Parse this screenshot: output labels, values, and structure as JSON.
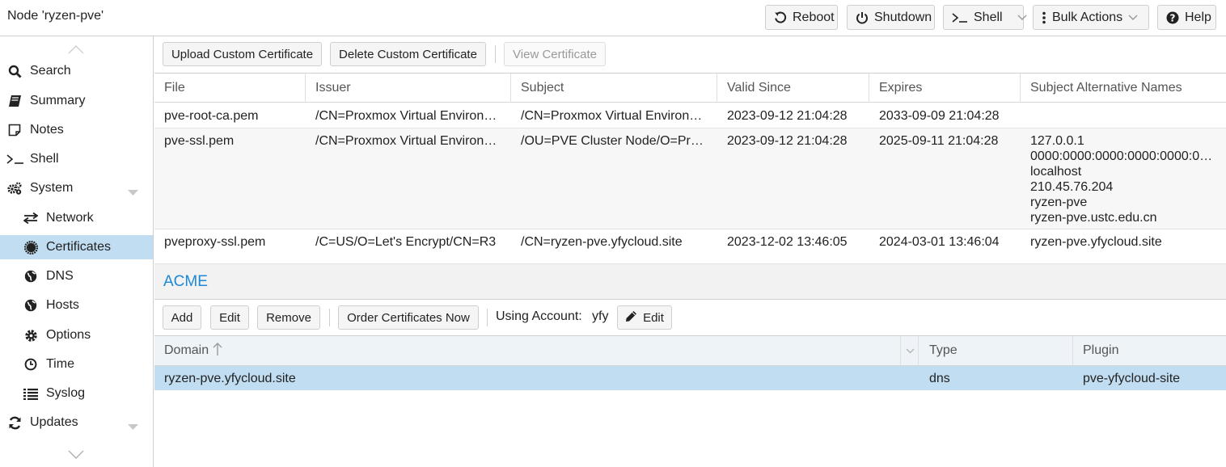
{
  "header": {
    "title": "Node 'ryzen-pve'",
    "reboot": "Reboot",
    "shutdown": "Shutdown",
    "shell": "Shell",
    "bulk_actions": "Bulk Actions",
    "help": "Help"
  },
  "sidebar": {
    "items": [
      {
        "label": "Search",
        "icon": "search-icon"
      },
      {
        "label": "Summary",
        "icon": "book-icon"
      },
      {
        "label": "Notes",
        "icon": "note-icon"
      },
      {
        "label": "Shell",
        "icon": "terminal-icon"
      },
      {
        "label": "System",
        "icon": "gears-icon"
      },
      {
        "label": "Network",
        "icon": "exchange-icon"
      },
      {
        "label": "Certificates",
        "icon": "certificate-icon"
      },
      {
        "label": "DNS",
        "icon": "globe-icon"
      },
      {
        "label": "Hosts",
        "icon": "globe-icon"
      },
      {
        "label": "Options",
        "icon": "gear-icon"
      },
      {
        "label": "Time",
        "icon": "clock-icon"
      },
      {
        "label": "Syslog",
        "icon": "list-icon"
      },
      {
        "label": "Updates",
        "icon": "refresh-icon"
      }
    ]
  },
  "certificates": {
    "toolbar": {
      "upload": "Upload Custom Certificate",
      "delete": "Delete Custom Certificate",
      "view": "View Certificate"
    },
    "columns": [
      "File",
      "Issuer",
      "Subject",
      "Valid Since",
      "Expires",
      "Subject Alternative Names"
    ],
    "rows": [
      {
        "file": "pve-root-ca.pem",
        "issuer": "/CN=Proxmox Virtual Environ…",
        "subject": "/CN=Proxmox Virtual Environ…",
        "valid_since": "2023-09-12 21:04:28",
        "expires": "2033-09-09 21:04:28",
        "san": []
      },
      {
        "file": "pve-ssl.pem",
        "issuer": "/CN=Proxmox Virtual Environ…",
        "subject": "/OU=PVE Cluster Node/O=Pr…",
        "valid_since": "2023-09-12 21:04:28",
        "expires": "2025-09-11 21:04:28",
        "san": [
          "127.0.0.1",
          "0000:0000:0000:0000:0000:0…",
          "localhost",
          "210.45.76.204",
          "ryzen-pve",
          "ryzen-pve.ustc.edu.cn"
        ]
      },
      {
        "file": "pveproxy-ssl.pem",
        "issuer": "/C=US/O=Let's Encrypt/CN=R3",
        "subject": "/CN=ryzen-pve.yfycloud.site",
        "valid_since": "2023-12-02 13:46:05",
        "expires": "2024-03-01 13:46:04",
        "san": [
          "ryzen-pve.yfycloud.site"
        ]
      }
    ]
  },
  "acme": {
    "title": "ACME",
    "toolbar": {
      "add": "Add",
      "edit": "Edit",
      "remove": "Remove",
      "order": "Order Certificates Now",
      "account_label": "Using Account:",
      "account_value": "yfy",
      "account_edit": "Edit"
    },
    "columns": [
      "Domain",
      "Type",
      "Plugin"
    ],
    "rows": [
      {
        "domain": "ryzen-pve.yfycloud.site",
        "type": "dns",
        "plugin": "pve-yfycloud-site"
      }
    ]
  },
  "colors": {
    "selected": "#c1ddf1",
    "accent": "#1e88d6"
  }
}
